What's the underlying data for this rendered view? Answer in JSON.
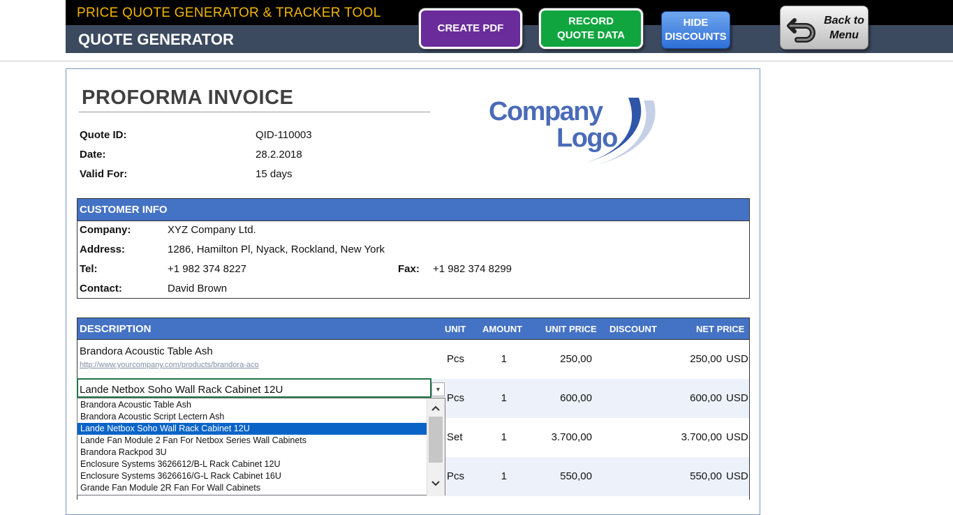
{
  "header": {
    "app_title": "PRICE QUOTE GENERATOR & TRACKER TOOL",
    "sheet_title": "QUOTE GENERATOR",
    "buttons": {
      "create_pdf": "CREATE PDF",
      "record_quote": "RECORD QUOTE DATA",
      "hide_discounts": "HIDE DISCOUNTS",
      "back_to_menu": "Back to Menu"
    },
    "colors": {
      "title": "#f2b705",
      "purple": "#6a2c9a",
      "green": "#11a540",
      "blue": "#2f6fd6"
    }
  },
  "invoice": {
    "title": "PROFORMA INVOICE",
    "fields": [
      {
        "label": "Quote ID:",
        "value": "QID-110003"
      },
      {
        "label": "Date:",
        "value": "28.2.2018"
      },
      {
        "label": "Valid For:",
        "value": "15 days"
      }
    ],
    "logo": {
      "line1": "Company",
      "line2": "Logo"
    }
  },
  "customer": {
    "header": "CUSTOMER INFO",
    "company_label": "Company:",
    "company": "XYZ Company Ltd.",
    "address_label": "Address:",
    "address": "1286, Hamilton Pl, Nyack, Rockland, New York",
    "tel_label": "Tel:",
    "tel": "+1 982 374 8227",
    "fax_label": "Fax:",
    "fax": "+1 982 374 8299",
    "contact_label": "Contact:",
    "contact": "David Brown"
  },
  "items": {
    "columns": [
      "DESCRIPTION",
      "UNIT",
      "AMOUNT",
      "UNIT PRICE",
      "DISCOUNT",
      "NET PRICE"
    ],
    "header_color": "#4472c4",
    "rows": [
      {
        "description": "Brandora Acoustic Table Ash",
        "link": "http://www.yourcompany.com/products/brandora-aco",
        "unit": "Pcs",
        "amount": "1",
        "unit_price": "250,00",
        "net_price": "250,00",
        "currency": "USD"
      },
      {
        "description": "Lande Netbox Soho Wall Rack Cabinet 12U",
        "unit": "Pcs",
        "amount": "1",
        "unit_price": "600,00",
        "net_price": "600,00",
        "currency": "USD"
      },
      {
        "unit": "Set",
        "amount": "1",
        "unit_price": "3.700,00",
        "net_price": "3.700,00",
        "currency": "USD"
      },
      {
        "unit": "Pcs",
        "amount": "1",
        "unit_price": "550,00",
        "net_price": "550,00",
        "currency": "USD"
      }
    ]
  },
  "dropdown": {
    "selected": "Lande Netbox Soho Wall Rack Cabinet 12U",
    "options": [
      "Brandora Acoustic Table Ash",
      "Brandora Acoustic Script Lectern Ash",
      "Lande Netbox Soho Wall Rack Cabinet 12U",
      "Lande Fan Module 2 Fan For Netbox Series Wall Cabinets",
      "Brandora Rackpod 3U",
      "Enclosure Systems 3626612/B-L Rack Cabinet 12U",
      "Enclosure Systems 3626616/G-L Rack Cabinet 16U",
      "Grande Fan Module 2R Fan For Wall Cabinets"
    ],
    "selected_index": 2
  }
}
